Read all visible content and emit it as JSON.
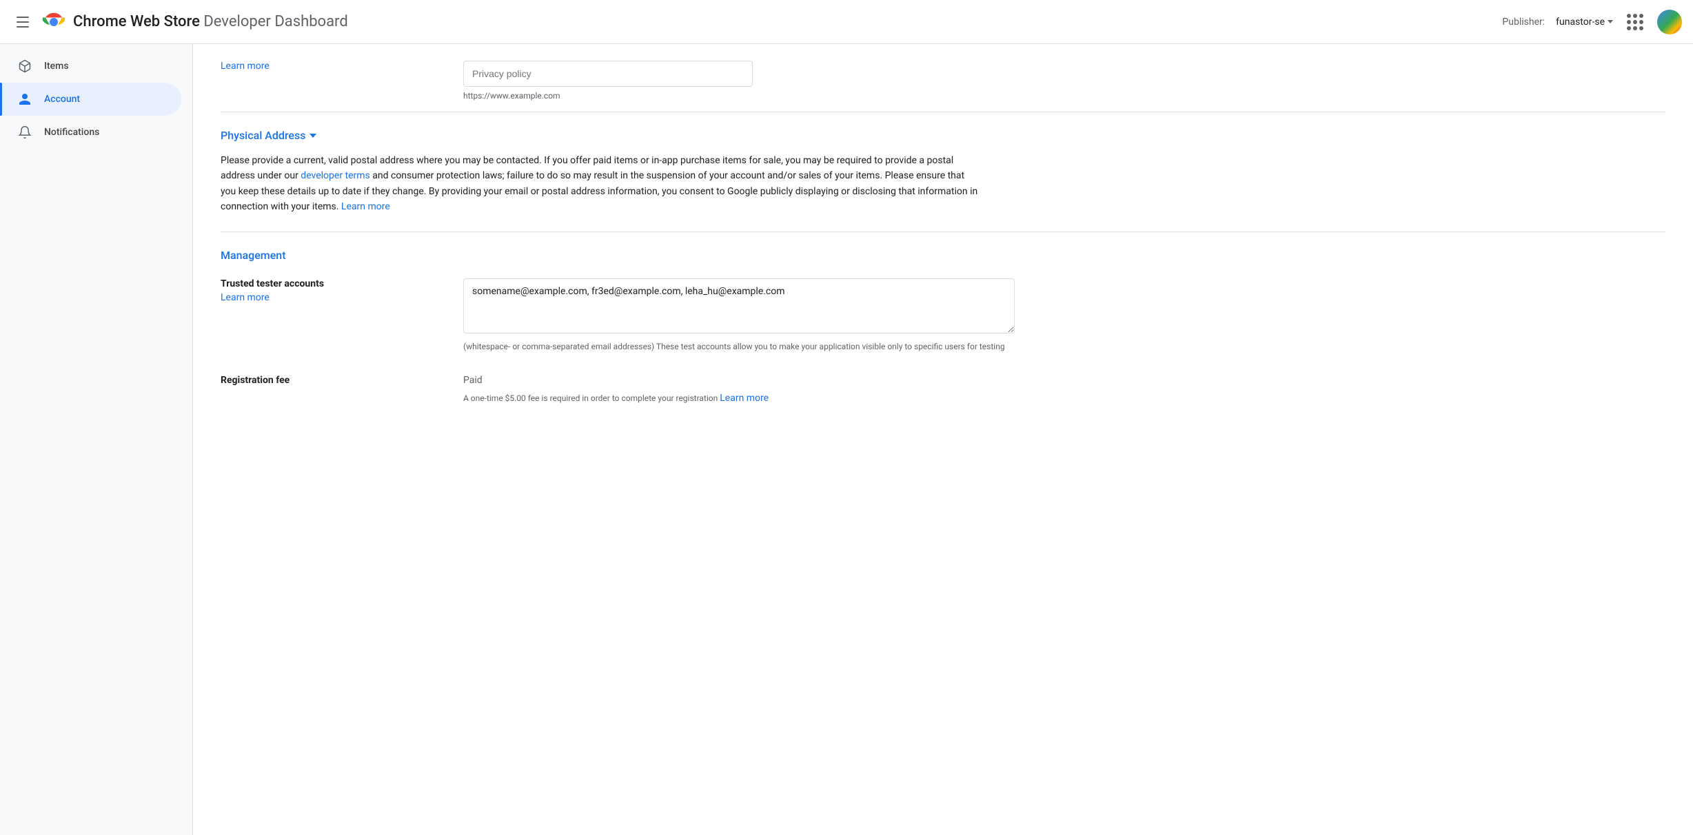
{
  "header": {
    "menu_icon_label": "menu",
    "app_name": "Chrome Web Store",
    "app_subtitle": "Developer Dashboard",
    "publisher_prefix": "Publisher:",
    "publisher_name": "funastor-se",
    "apps_grid_label": "Google apps",
    "avatar_label": "User avatar"
  },
  "sidebar": {
    "items": [
      {
        "id": "items",
        "label": "Items",
        "icon": "package-icon",
        "active": false
      },
      {
        "id": "account",
        "label": "Account",
        "icon": "account-icon",
        "active": true
      },
      {
        "id": "notifications",
        "label": "Notifications",
        "icon": "bell-icon",
        "active": false
      }
    ]
  },
  "main": {
    "privacy_policy": {
      "learn_more": "Learn more",
      "input_placeholder": "Privacy policy",
      "input_hint": "https://www.example.com"
    },
    "physical_address": {
      "title": "Physical Address",
      "description": "Please provide a current, valid postal address where you may be contacted. If you offer paid items or in-app purchase items for sale, you may be required to provide a postal address under our",
      "developer_terms_link": "developer terms",
      "description_2": "and consumer protection laws; failure to do so may result in the suspension of your account and/or sales of your items. Please ensure that you keep these details up to date if they change. By providing your email or postal address information, you consent to Google publicly displaying or disclosing that information in connection with your items.",
      "learn_more": "Learn more"
    },
    "management": {
      "title": "Management",
      "trusted_tester": {
        "label": "Trusted tester accounts",
        "learn_more": "Learn more",
        "value": "somename@example.com, fr3ed@example.com, leha_hu@example.com",
        "hint": "(whitespace- or comma-separated email addresses) These test accounts allow you to make your application visible only to specific users for testing"
      },
      "registration_fee": {
        "label": "Registration fee",
        "value": "Paid",
        "hint": "A one-time $5.00 fee is required in order to complete your registration",
        "learn_more": "Learn more"
      }
    }
  }
}
